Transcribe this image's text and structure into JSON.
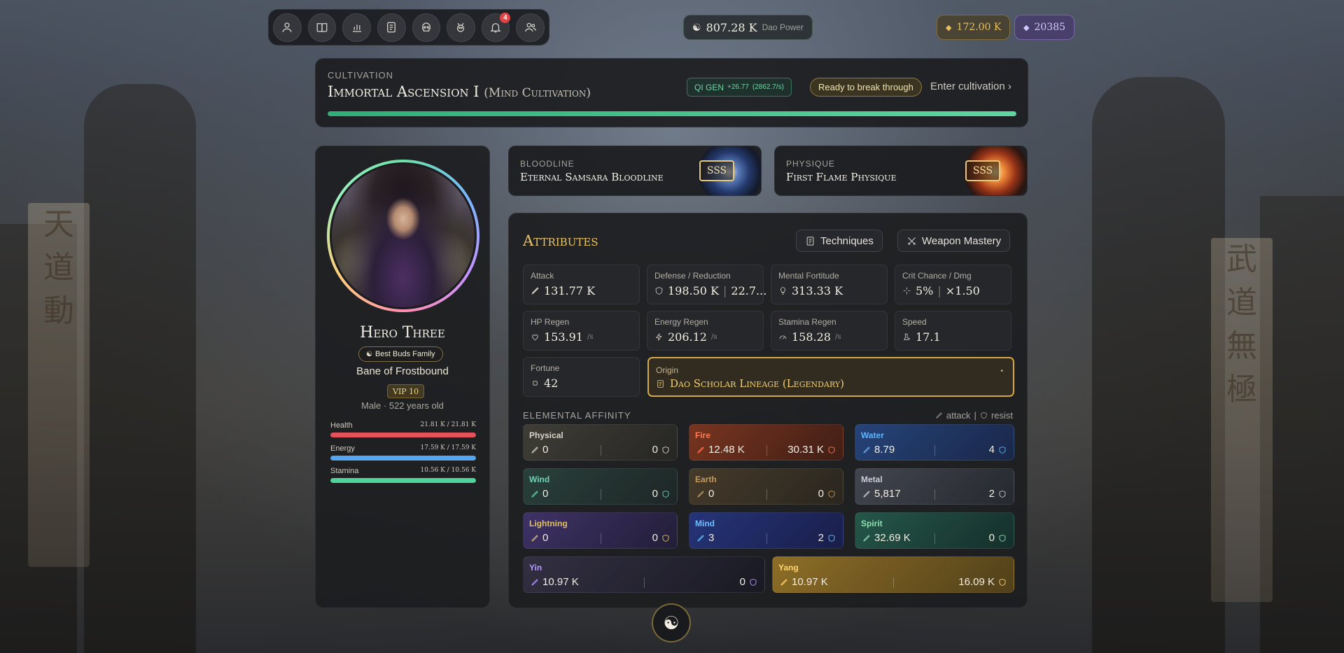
{
  "nav": {
    "items": [
      {
        "name": "nav-profile-button",
        "icon": "user-icon"
      },
      {
        "name": "nav-codex-button",
        "icon": "book-icon"
      },
      {
        "name": "nav-stats-button",
        "icon": "bar-chart-icon"
      },
      {
        "name": "nav-log-button",
        "icon": "scroll-icon"
      },
      {
        "name": "nav-dungeon-button",
        "icon": "skull-icon"
      },
      {
        "name": "nav-pet-button",
        "icon": "beast-icon"
      },
      {
        "name": "nav-notifications-button",
        "icon": "bell-icon",
        "badge": "4"
      },
      {
        "name": "nav-friends-button",
        "icon": "users-icon"
      }
    ]
  },
  "header": {
    "dao_power_value": "807.28 K",
    "dao_power_label": "Dao Power",
    "gold": "172.00 K",
    "gems": "20385"
  },
  "cultivation": {
    "label": "CULTIVATION",
    "realm": "Immortal Ascension I",
    "path": "(Mind Cultivation)",
    "qi_label": "QI GEN",
    "qi_value": "+26.77",
    "qi_rate": "(2862.7/s)",
    "status": "Ready to break through",
    "enter": "Enter cultivation ›",
    "progress": 1.0
  },
  "profile": {
    "name": "Hero Three",
    "family": "Best Buds Family",
    "title": "Bane of Frostbound",
    "vip": "VIP 10",
    "meta": "Male · 522 years old",
    "bars": [
      {
        "label": "Health",
        "value": "21.81 K / 21.81 K",
        "fraction": 1.0,
        "color": "#e5535a"
      },
      {
        "label": "Energy",
        "value": "17.59 K / 17.59 K",
        "fraction": 1.0,
        "color": "#55a6f0"
      },
      {
        "label": "Stamina",
        "value": "10.56 K / 10.56 K",
        "fraction": 1.0,
        "color": "#4fd59b"
      }
    ]
  },
  "bloodline": {
    "label": "BLOODLINE",
    "name": "Eternal Samsara Bloodline",
    "grade": "SSS"
  },
  "physique": {
    "label": "PHYSIQUE",
    "name": "First Flame Physique",
    "grade": "SSS"
  },
  "attributes": {
    "heading": "Attributes",
    "techniques": "Techniques",
    "weapon_mastery": "Weapon Mastery",
    "stats": {
      "attack": {
        "label": "Attack",
        "value": "131.77 K"
      },
      "defense": {
        "label": "Defense / Reduction",
        "value": "198.50 K",
        "value2": "22.7..."
      },
      "mental": {
        "label": "Mental Fortitude",
        "value": "313.33 K"
      },
      "crit": {
        "label": "Crit Chance / Dmg",
        "value": "5%",
        "value2": "×1.50"
      },
      "hp_regen": {
        "label": "HP Regen",
        "value": "153.91",
        "unit": "/s"
      },
      "energy_regen": {
        "label": "Energy Regen",
        "value": "206.12",
        "unit": "/s"
      },
      "stamina_regen": {
        "label": "Stamina Regen",
        "value": "158.28",
        "unit": "/s"
      },
      "speed": {
        "label": "Speed",
        "value": "17.1"
      },
      "fortune": {
        "label": "Fortune",
        "value": "42"
      }
    },
    "origin": {
      "label": "Origin",
      "value": "Dao Scholar Lineage (Legendary)"
    },
    "elemental_heading": "ELEMENTAL AFFINITY",
    "legend_attack": "attack",
    "legend_resist": "resist",
    "elements": [
      {
        "name": "Physical",
        "attack": "0",
        "resist": "0",
        "color": "#d8d4c8"
      },
      {
        "name": "Fire",
        "attack": "12.48 K",
        "resist": "30.31 K",
        "color": "#ff7a55"
      },
      {
        "name": "Water",
        "attack": "8.79",
        "resist": "4",
        "color": "#5fb4ff"
      },
      {
        "name": "Wind",
        "attack": "0",
        "resist": "0",
        "color": "#6fd2b4"
      },
      {
        "name": "Earth",
        "attack": "0",
        "resist": "0",
        "color": "#c29a5a"
      },
      {
        "name": "Metal",
        "attack": "5,817",
        "resist": "2",
        "color": "#c9ccd4"
      },
      {
        "name": "Lightning",
        "attack": "0",
        "resist": "0",
        "color": "#e3c25a"
      },
      {
        "name": "Mind",
        "attack": "3",
        "resist": "2",
        "color": "#6cc0ff"
      },
      {
        "name": "Spirit",
        "attack": "32.69 K",
        "resist": "0",
        "color": "#8fe0b0"
      },
      {
        "name": "Yin",
        "attack": "10.97 K",
        "resist": "0",
        "color": "#b79aff"
      },
      {
        "name": "Yang",
        "attack": "10.97 K",
        "resist": "16.09 K",
        "color": "#ffd470"
      }
    ]
  }
}
